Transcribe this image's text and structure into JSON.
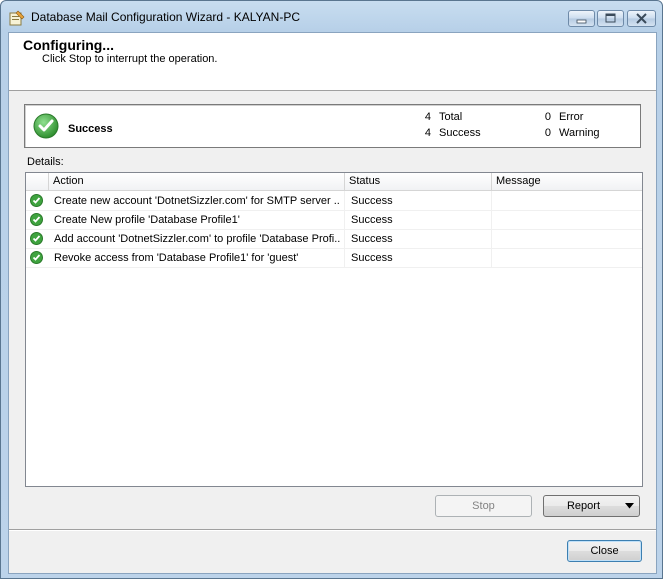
{
  "window": {
    "title": "Database Mail Configuration Wizard - KALYAN-PC"
  },
  "header": {
    "title": "Configuring...",
    "subtitle": "Click Stop to interrupt the operation."
  },
  "summary": {
    "status_label": "Success",
    "total_count": "4",
    "total_label": "Total",
    "success_count": "4",
    "success_label": "Success",
    "error_count": "0",
    "error_label": "Error",
    "warning_count": "0",
    "warning_label": "Warning"
  },
  "details": {
    "label": "Details:",
    "columns": {
      "action": "Action",
      "status": "Status",
      "message": "Message"
    },
    "rows": [
      {
        "action": "Create new account 'DotnetSizzler.com' for SMTP server ...",
        "status": "Success",
        "message": ""
      },
      {
        "action": "Create New profile 'Database Profile1'",
        "status": "Success",
        "message": ""
      },
      {
        "action": "Add account 'DotnetSizzler.com' to profile 'Database Profi...",
        "status": "Success",
        "message": ""
      },
      {
        "action": "Revoke access from 'Database Profile1' for 'guest'",
        "status": "Success",
        "message": ""
      }
    ]
  },
  "buttons": {
    "stop": "Stop",
    "report": "Report",
    "close": "Close"
  },
  "icons": {
    "success": "success-check-icon",
    "app": "mail-wizard-icon"
  },
  "colors": {
    "success_green": "#3fa33f",
    "title_bar": "#bcd3ea"
  }
}
